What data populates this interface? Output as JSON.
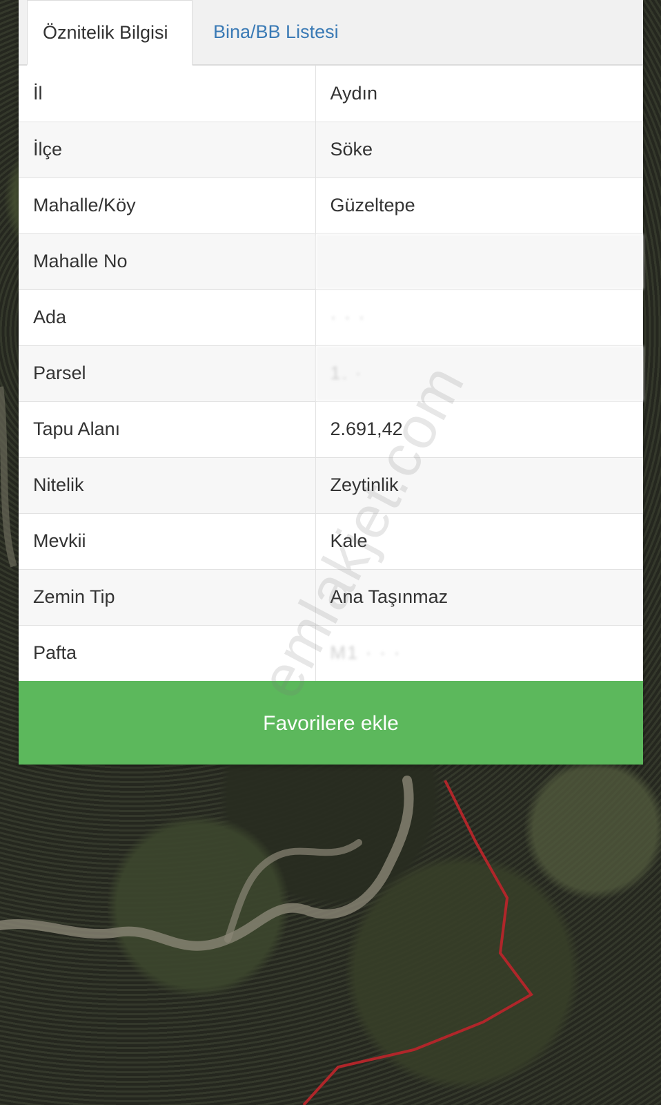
{
  "tabs": {
    "attributes_label": "Öznitelik Bilgisi",
    "buildings_label": "Bina/BB Listesi"
  },
  "attributes": [
    {
      "label": "İl",
      "value": "Aydın"
    },
    {
      "label": "İlçe",
      "value": "Söke"
    },
    {
      "label": "Mahalle/Köy",
      "value": "Güzeltepe"
    },
    {
      "label": "Mahalle No",
      "value": ""
    },
    {
      "label": "Ada",
      "value": "· · ·"
    },
    {
      "label": "Parsel",
      "value": "1. ·"
    },
    {
      "label": "Tapu Alanı",
      "value": "2.691,42"
    },
    {
      "label": "Nitelik",
      "value": "Zeytinlik"
    },
    {
      "label": "Mevkii",
      "value": "Kale"
    },
    {
      "label": "Zemin Tip",
      "value": "Ana Taşınmaz"
    },
    {
      "label": "Pafta",
      "value": "M1 · · ·"
    }
  ],
  "actions": {
    "favorite_label": "Favorilere ekle"
  },
  "watermark": "emlakjet.com",
  "colors": {
    "button_green": "#5cb85c",
    "tab_link_blue": "#3a7ab5",
    "parcel_border_red": "#b0262a"
  }
}
